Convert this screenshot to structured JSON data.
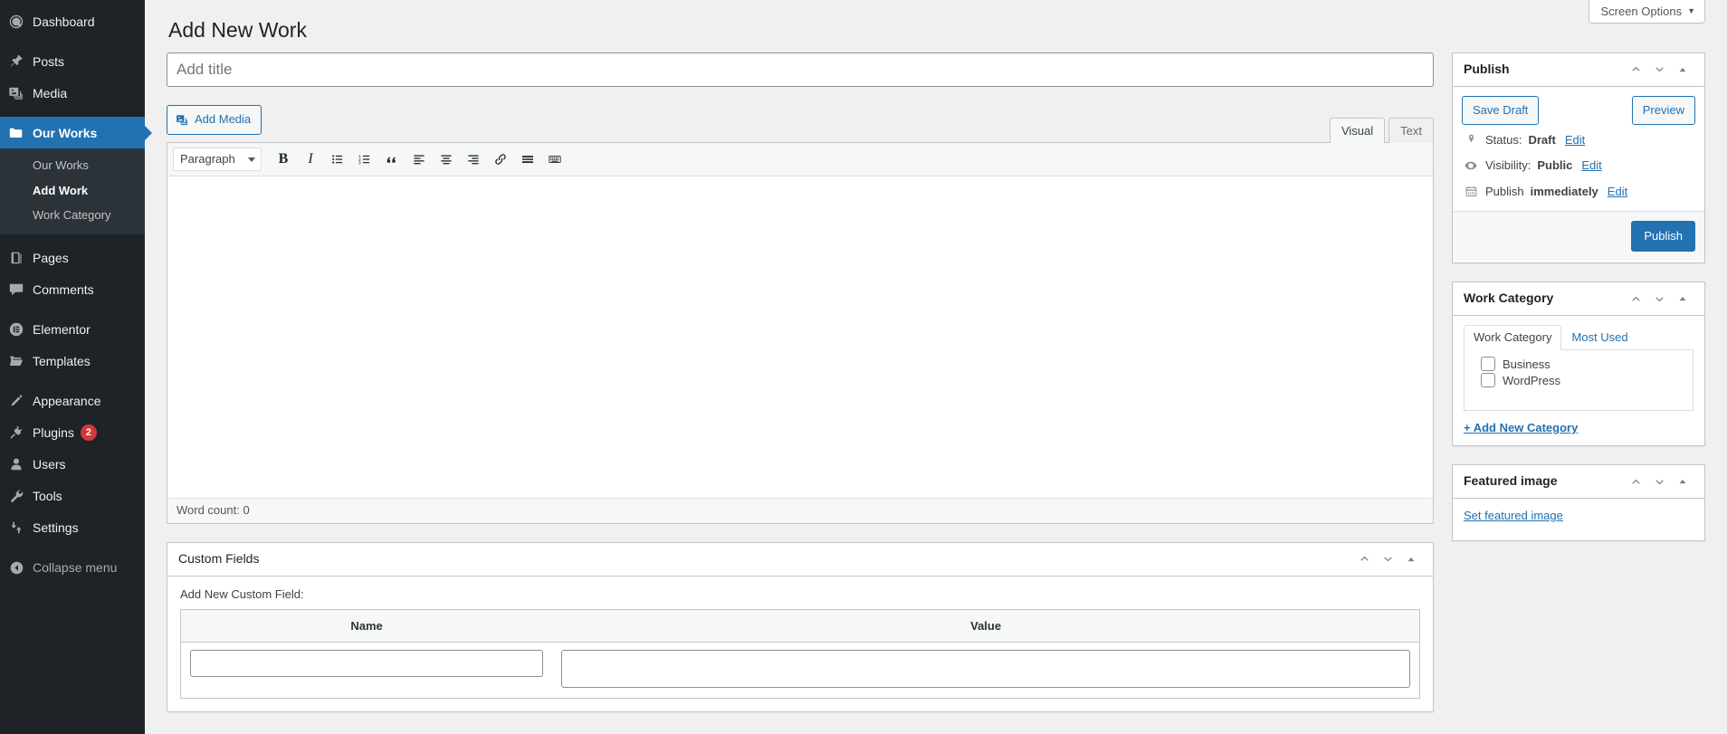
{
  "sidebar": {
    "items": [
      {
        "label": "Dashboard",
        "icon": "dashboard-icon",
        "current": false
      },
      {
        "label": "Posts",
        "icon": "pin-icon",
        "current": false
      },
      {
        "label": "Media",
        "icon": "media-icon",
        "current": false
      },
      {
        "label": "Our Works",
        "icon": "folder-icon",
        "current": true
      },
      {
        "label": "Pages",
        "icon": "pages-icon",
        "current": false
      },
      {
        "label": "Comments",
        "icon": "comments-icon",
        "current": false
      },
      {
        "label": "Elementor",
        "icon": "elementor-icon",
        "current": false
      },
      {
        "label": "Templates",
        "icon": "templates-icon",
        "current": false
      },
      {
        "label": "Appearance",
        "icon": "brush-icon",
        "current": false
      },
      {
        "label": "Plugins",
        "icon": "plugin-icon",
        "current": false,
        "badge": "2"
      },
      {
        "label": "Users",
        "icon": "user-icon",
        "current": false
      },
      {
        "label": "Tools",
        "icon": "wrench-icon",
        "current": false
      },
      {
        "label": "Settings",
        "icon": "sliders-icon",
        "current": false
      }
    ],
    "submenu": [
      {
        "label": "Our Works",
        "current": false
      },
      {
        "label": "Add Work",
        "current": true
      },
      {
        "label": "Work Category",
        "current": false
      }
    ],
    "collapse": {
      "label": "Collapse menu",
      "icon": "collapse-arrow-icon"
    }
  },
  "screen_meta": {
    "screen_options_label": "Screen Options",
    "caret": "▼"
  },
  "page": {
    "title": "Add New Work"
  },
  "title_field": {
    "placeholder": "Add title",
    "value": ""
  },
  "editor": {
    "add_media_label": "Add Media",
    "tabs": [
      {
        "label": "Visual",
        "active": true
      },
      {
        "label": "Text",
        "active": false
      }
    ],
    "format_options": [
      "Paragraph"
    ],
    "format_selected": "Paragraph",
    "toolbar_buttons": [
      {
        "name": "bold-icon",
        "glyph": "B"
      },
      {
        "name": "italic-icon",
        "glyph": "I"
      },
      {
        "name": "bulleted-list-icon",
        "glyph": ""
      },
      {
        "name": "numbered-list-icon",
        "glyph": ""
      },
      {
        "name": "blockquote-icon",
        "glyph": "“"
      },
      {
        "name": "align-left-icon",
        "glyph": ""
      },
      {
        "name": "align-center-icon",
        "glyph": ""
      },
      {
        "name": "align-right-icon",
        "glyph": ""
      },
      {
        "name": "link-icon",
        "glyph": ""
      },
      {
        "name": "read-more-icon",
        "glyph": ""
      },
      {
        "name": "toolbar-toggle-icon",
        "glyph": ""
      }
    ],
    "content": "",
    "statusbar": "Word count: 0"
  },
  "publish_box": {
    "title": "Publish",
    "save_draft_label": "Save Draft",
    "preview_label": "Preview",
    "status_prefix": "Status:",
    "status_value": "Draft",
    "visibility_prefix": "Visibility:",
    "visibility_value": "Public",
    "schedule_prefix": "Publish",
    "schedule_value": "immediately",
    "edit_label": "Edit",
    "publish_label": "Publish"
  },
  "work_category_box": {
    "title": "Work Category",
    "tabs": [
      {
        "label": "Work Category",
        "active": true
      },
      {
        "label": "Most Used",
        "active": false
      }
    ],
    "categories": [
      {
        "label": "Business",
        "checked": false
      },
      {
        "label": "WordPress",
        "checked": false
      }
    ],
    "add_new_label": "+ Add New Category"
  },
  "featured_image_box": {
    "title": "Featured image",
    "set_label": "Set featured image"
  },
  "custom_fields_box": {
    "title": "Custom Fields",
    "add_new_label": "Add New Custom Field:",
    "columns": [
      "Name",
      "Value"
    ],
    "row": {
      "name_value": "",
      "value_value": ""
    }
  },
  "colors": {
    "accent": "#2271b1",
    "sidebar_bg": "#1d2327",
    "submenu_bg": "#2c3338",
    "badge": "#d63638",
    "body_bg": "#f0f0f1"
  }
}
